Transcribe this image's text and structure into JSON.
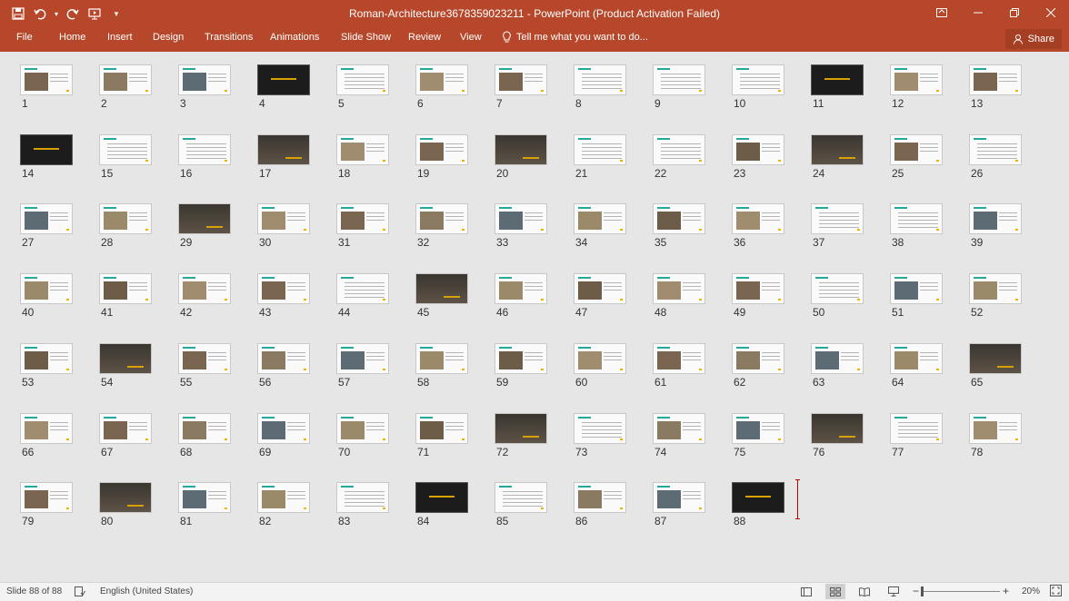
{
  "window": {
    "title": "Roman-Architecture3678359023211 - PowerPoint (Product Activation Failed)"
  },
  "ribbon": {
    "file": "File",
    "tabs": [
      "Home",
      "Insert",
      "Design",
      "Transitions",
      "Animations",
      "Slide Show",
      "Review",
      "View"
    ],
    "tell_me": "Tell me what you want to do...",
    "share": "Share"
  },
  "slides": [
    {
      "n": "1",
      "s": "p"
    },
    {
      "n": "2",
      "s": "p"
    },
    {
      "n": "3",
      "s": "p"
    },
    {
      "n": "4",
      "s": "d"
    },
    {
      "n": "5",
      "s": "t"
    },
    {
      "n": "6",
      "s": "p"
    },
    {
      "n": "7",
      "s": "p"
    },
    {
      "n": "8",
      "s": "t"
    },
    {
      "n": "9",
      "s": "t"
    },
    {
      "n": "10",
      "s": "t"
    },
    {
      "n": "11",
      "s": "d"
    },
    {
      "n": "12",
      "s": "p"
    },
    {
      "n": "13",
      "s": "p"
    },
    {
      "n": "14",
      "s": "d"
    },
    {
      "n": "15",
      "s": "t"
    },
    {
      "n": "16",
      "s": "t"
    },
    {
      "n": "17",
      "s": "i"
    },
    {
      "n": "18",
      "s": "p"
    },
    {
      "n": "19",
      "s": "p"
    },
    {
      "n": "20",
      "s": "i"
    },
    {
      "n": "21",
      "s": "t"
    },
    {
      "n": "22",
      "s": "t"
    },
    {
      "n": "23",
      "s": "p"
    },
    {
      "n": "24",
      "s": "i"
    },
    {
      "n": "25",
      "s": "p"
    },
    {
      "n": "26",
      "s": "t"
    },
    {
      "n": "27",
      "s": "p"
    },
    {
      "n": "28",
      "s": "p"
    },
    {
      "n": "29",
      "s": "i"
    },
    {
      "n": "30",
      "s": "p"
    },
    {
      "n": "31",
      "s": "p"
    },
    {
      "n": "32",
      "s": "p"
    },
    {
      "n": "33",
      "s": "p"
    },
    {
      "n": "34",
      "s": "p"
    },
    {
      "n": "35",
      "s": "p"
    },
    {
      "n": "36",
      "s": "p"
    },
    {
      "n": "37",
      "s": "t"
    },
    {
      "n": "38",
      "s": "t"
    },
    {
      "n": "39",
      "s": "p"
    },
    {
      "n": "40",
      "s": "p"
    },
    {
      "n": "41",
      "s": "p"
    },
    {
      "n": "42",
      "s": "p"
    },
    {
      "n": "43",
      "s": "p"
    },
    {
      "n": "44",
      "s": "t"
    },
    {
      "n": "45",
      "s": "i"
    },
    {
      "n": "46",
      "s": "p"
    },
    {
      "n": "47",
      "s": "p"
    },
    {
      "n": "48",
      "s": "p"
    },
    {
      "n": "49",
      "s": "p"
    },
    {
      "n": "50",
      "s": "t"
    },
    {
      "n": "51",
      "s": "p"
    },
    {
      "n": "52",
      "s": "p"
    },
    {
      "n": "53",
      "s": "p"
    },
    {
      "n": "54",
      "s": "i"
    },
    {
      "n": "55",
      "s": "p"
    },
    {
      "n": "56",
      "s": "p"
    },
    {
      "n": "57",
      "s": "p"
    },
    {
      "n": "58",
      "s": "p"
    },
    {
      "n": "59",
      "s": "p"
    },
    {
      "n": "60",
      "s": "p"
    },
    {
      "n": "61",
      "s": "p"
    },
    {
      "n": "62",
      "s": "p"
    },
    {
      "n": "63",
      "s": "p"
    },
    {
      "n": "64",
      "s": "p"
    },
    {
      "n": "65",
      "s": "i"
    },
    {
      "n": "66",
      "s": "p"
    },
    {
      "n": "67",
      "s": "p"
    },
    {
      "n": "68",
      "s": "p"
    },
    {
      "n": "69",
      "s": "p"
    },
    {
      "n": "70",
      "s": "p"
    },
    {
      "n": "71",
      "s": "p"
    },
    {
      "n": "72",
      "s": "i"
    },
    {
      "n": "73",
      "s": "t"
    },
    {
      "n": "74",
      "s": "p"
    },
    {
      "n": "75",
      "s": "p"
    },
    {
      "n": "76",
      "s": "i"
    },
    {
      "n": "77",
      "s": "t"
    },
    {
      "n": "78",
      "s": "p"
    },
    {
      "n": "79",
      "s": "p"
    },
    {
      "n": "80",
      "s": "i"
    },
    {
      "n": "81",
      "s": "p"
    },
    {
      "n": "82",
      "s": "p"
    },
    {
      "n": "83",
      "s": "t"
    },
    {
      "n": "84",
      "s": "d"
    },
    {
      "n": "85",
      "s": "t"
    },
    {
      "n": "86",
      "s": "p"
    },
    {
      "n": "87",
      "s": "p"
    },
    {
      "n": "88",
      "s": "d"
    }
  ],
  "status": {
    "slide_info": "Slide 88 of 88",
    "language": "English (United States)",
    "zoom": "20%"
  },
  "colors": {
    "accent": "#b7472a",
    "teal": "#22a99a",
    "gold": "#f0b400"
  }
}
